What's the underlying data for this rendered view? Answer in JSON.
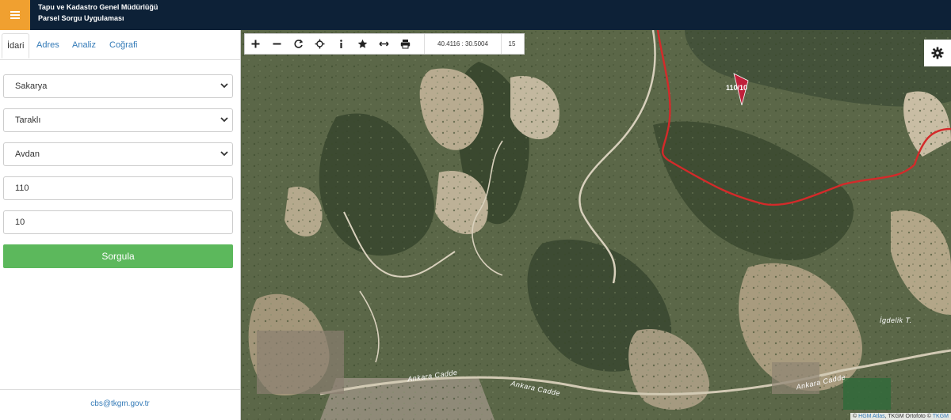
{
  "header": {
    "title_line1": "Tapu ve Kadastro Genel Müdürlüğü",
    "title_line2": "Parsel Sorgu Uygulaması",
    "menu_icon": "hamburger-icon",
    "colors": {
      "bar": "#0d2137",
      "menu_button": "#f0a030"
    }
  },
  "sidebar": {
    "tabs": [
      {
        "label": "İdari",
        "active": true
      },
      {
        "label": "Adres",
        "active": false
      },
      {
        "label": "Analiz",
        "active": false
      },
      {
        "label": "Coğrafi",
        "active": false
      }
    ],
    "province": "Sakarya",
    "district": "Taraklı",
    "neighborhood": "Avdan",
    "block": "110",
    "parcel": "10",
    "submit_label": "Sorgula",
    "footer_email": "cbs@tkgm.gov.tr",
    "colors": {
      "submit": "#5cb85c",
      "link": "#337ab7"
    }
  },
  "map": {
    "coordinates": "40.4116 : 30.5004",
    "zoom": "15",
    "parcel_label": "110/10",
    "place_labels": {
      "ankara_caddesi_1": "Ankara Cadde",
      "ankara_caddesi_2": "Ankara Cadde",
      "ankara_caddesi_3": "Ankara Cadde",
      "igdelik": "İgdelik T."
    },
    "attribution": {
      "prefix": "©",
      "hgm": "HGM Atlas",
      "middle": ", TKGM Ortofoto ©",
      "tkgm": "TKGM"
    },
    "toolbar_icons": [
      "plus-icon",
      "minus-icon",
      "refresh-icon",
      "locate-icon",
      "info-icon",
      "star-icon",
      "measure-icon",
      "print-icon"
    ],
    "colors": {
      "boundary": "#d42a2a",
      "parcel": "#c0203a"
    }
  }
}
